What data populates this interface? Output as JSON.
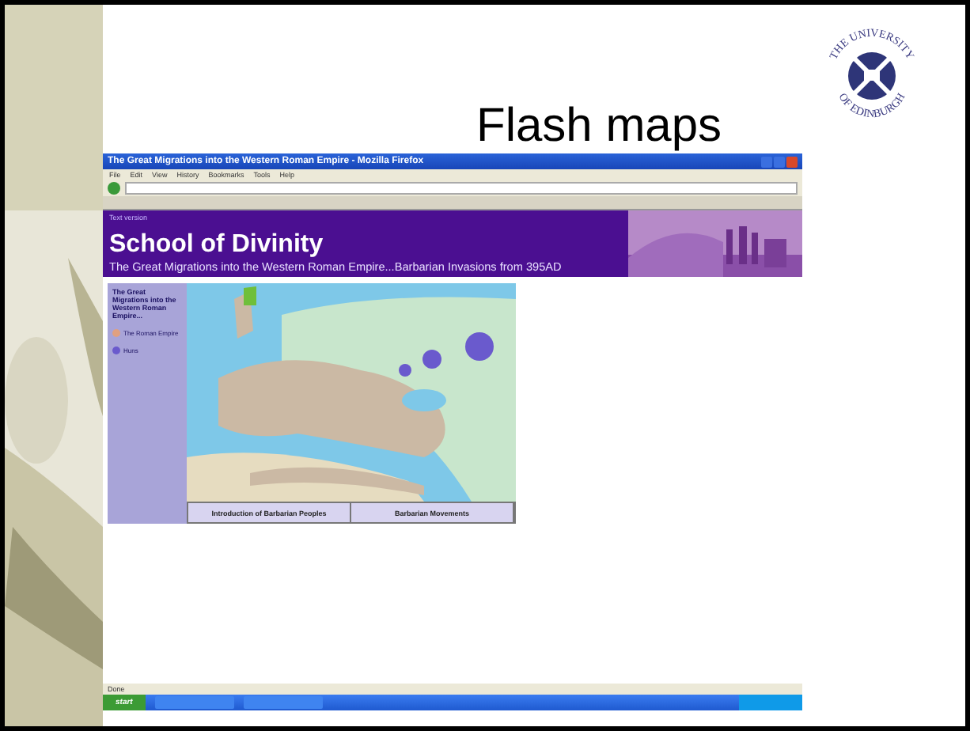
{
  "slide": {
    "title": "Flash maps",
    "logo": {
      "top_text": "THE UNIVERSITY",
      "bottom_text": "OF EDINBURGH"
    }
  },
  "browser": {
    "window_title": "The Great Migrations into the Western Roman Empire - Mozilla Firefox",
    "menu": [
      "File",
      "Edit",
      "View",
      "History",
      "Bookmarks",
      "Tools",
      "Help"
    ],
    "page": {
      "skip_link": "Text version",
      "heading": "School of Divinity",
      "subtitle": "The Great Migrations into the Western Roman Empire...Barbarian Invasions from 395AD",
      "sidebar_title": "The Great Migrations into the Western Roman Empire...",
      "legend": [
        {
          "label": "The Roman Empire",
          "color": "#e0a080"
        },
        {
          "label": "Huns",
          "color": "#6a5acd"
        }
      ],
      "map_tabs": [
        "Introduction of Barbarian Peoples",
        "Barbarian Movements"
      ]
    },
    "status": "Done",
    "taskbar": {
      "start": "start"
    }
  }
}
